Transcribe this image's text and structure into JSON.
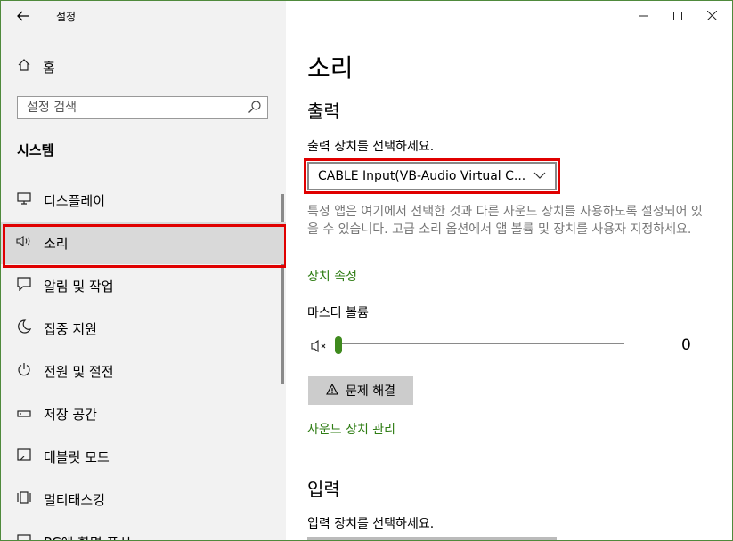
{
  "app": {
    "title": "설정"
  },
  "sidebar": {
    "home_label": "홈",
    "search_placeholder": "설정 검색",
    "section_title": "시스템",
    "items": [
      {
        "label": "디스플레이",
        "icon": "monitor-icon"
      },
      {
        "label": "소리",
        "icon": "speaker-icon",
        "selected": true
      },
      {
        "label": "알림 및 작업",
        "icon": "notification-icon"
      },
      {
        "label": "집중 지원",
        "icon": "moon-icon"
      },
      {
        "label": "전원 및 절전",
        "icon": "power-icon"
      },
      {
        "label": "저장 공간",
        "icon": "storage-icon"
      },
      {
        "label": "태블릿 모드",
        "icon": "tablet-icon"
      },
      {
        "label": "멀티태스킹",
        "icon": "multitask-icon"
      },
      {
        "label": "PC에 화면 표시",
        "icon": "project-icon"
      }
    ]
  },
  "main": {
    "title": "소리",
    "output": {
      "heading": "출력",
      "choose_label": "출력 장치를 선택하세요.",
      "selected_device": "CABLE Input(VB-Audio Virtual C...",
      "description": "특정 앱은 여기에서 선택한 것과 다른 사운드 장치를 사용하도록 설정되어 있을 수 있습니다. 고급 소리 옵션에서 앱 볼륨 및 장치를 사용자 지정하세요.",
      "device_properties_link": "장치 속성",
      "master_volume_label": "마스터 볼륨",
      "volume_value": "0",
      "troubleshoot_label": "문제 해결",
      "manage_devices_link": "사운드 장치 관리"
    },
    "input": {
      "heading": "입력",
      "choose_label": "입력 장치를 선택하세요."
    }
  },
  "colors": {
    "accent": "#3f8a1e",
    "link": "#2f7d14",
    "highlight": "#e00000",
    "selected_bg": "#d9d9d9"
  }
}
